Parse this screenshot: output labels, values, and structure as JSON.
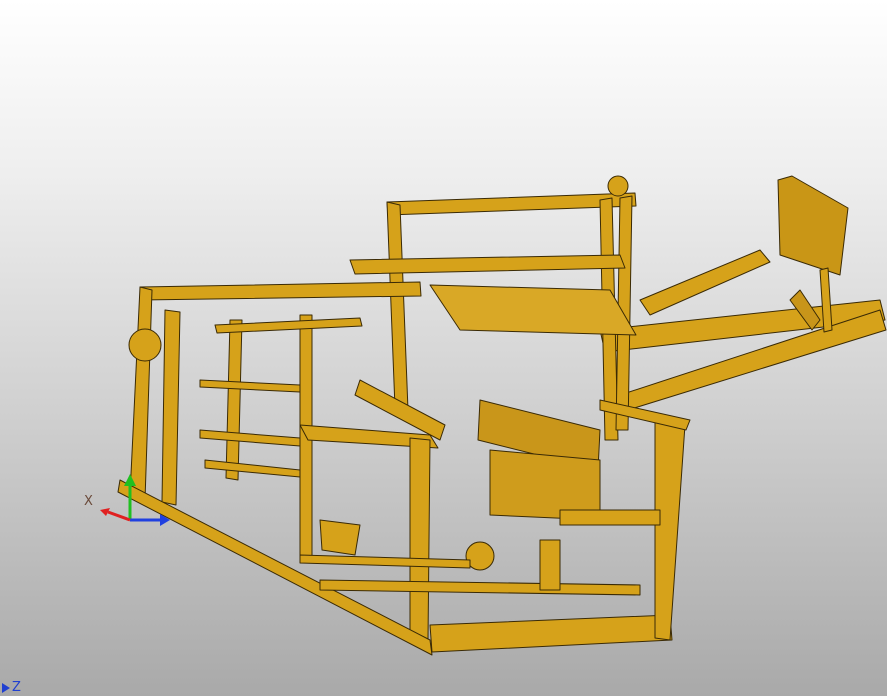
{
  "viewport": {
    "background_top": "#ffffff",
    "background_bottom": "#a9a9a9",
    "model_color": "#d6a21a",
    "model_edge_color": "#3a2a05"
  },
  "triad": {
    "x_label": "X",
    "x_color": "#e02020",
    "y_color": "#20c020",
    "z_color": "#2040e0"
  },
  "corner_indicator": {
    "label": "Z",
    "color": "#2040d0"
  }
}
